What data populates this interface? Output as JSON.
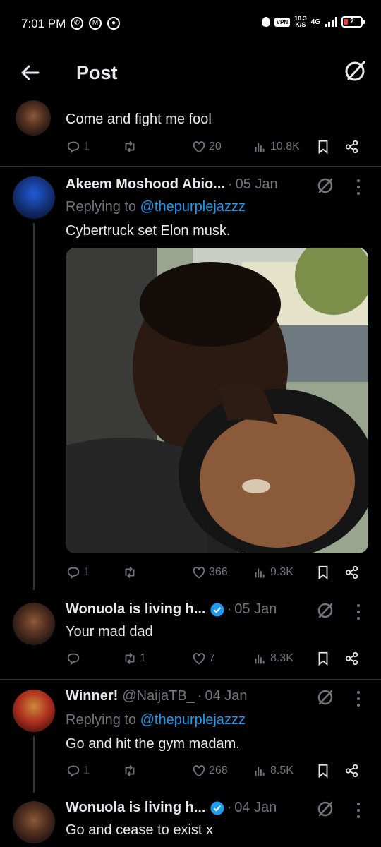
{
  "status": {
    "time": "7:01 PM",
    "net_speed_top": "10.3",
    "net_speed_bottom": "K/S",
    "network": "4G",
    "vpn": "VPN",
    "battery": "2"
  },
  "header": {
    "title": "Post"
  },
  "tweets": [
    {
      "text": "Come and fight me fool",
      "replies": "1",
      "likes": "20",
      "views": "10.8K"
    },
    {
      "name": "Akeem Moshood Abio...",
      "date": "05 Jan",
      "replying_label": "Replying to",
      "replying_handle": "@thepurplejazzz",
      "text": "Cybertruck set Elon musk.",
      "replies": "1",
      "likes": "366",
      "views": "9.3K"
    },
    {
      "name": "Wonuola is living h...",
      "date": "05 Jan",
      "text": "Your mad dad",
      "retweets": "1",
      "likes": "7",
      "views": "8.3K"
    },
    {
      "name": "Winner!",
      "handle": "@NaijaTB_",
      "date": "04 Jan",
      "replying_label": "Replying to",
      "replying_handle": "@thepurplejazzz",
      "text": "Go and hit the gym madam.",
      "replies": "1",
      "likes": "268",
      "views": "8.5K"
    },
    {
      "name": "Wonuola is living h...",
      "date": "04 Jan",
      "text": "Go and cease to exist x"
    }
  ],
  "colors": {
    "background": "#000000",
    "link": "#1d9bf0",
    "muted": "#71767b",
    "verified": "#1d9bf0"
  }
}
